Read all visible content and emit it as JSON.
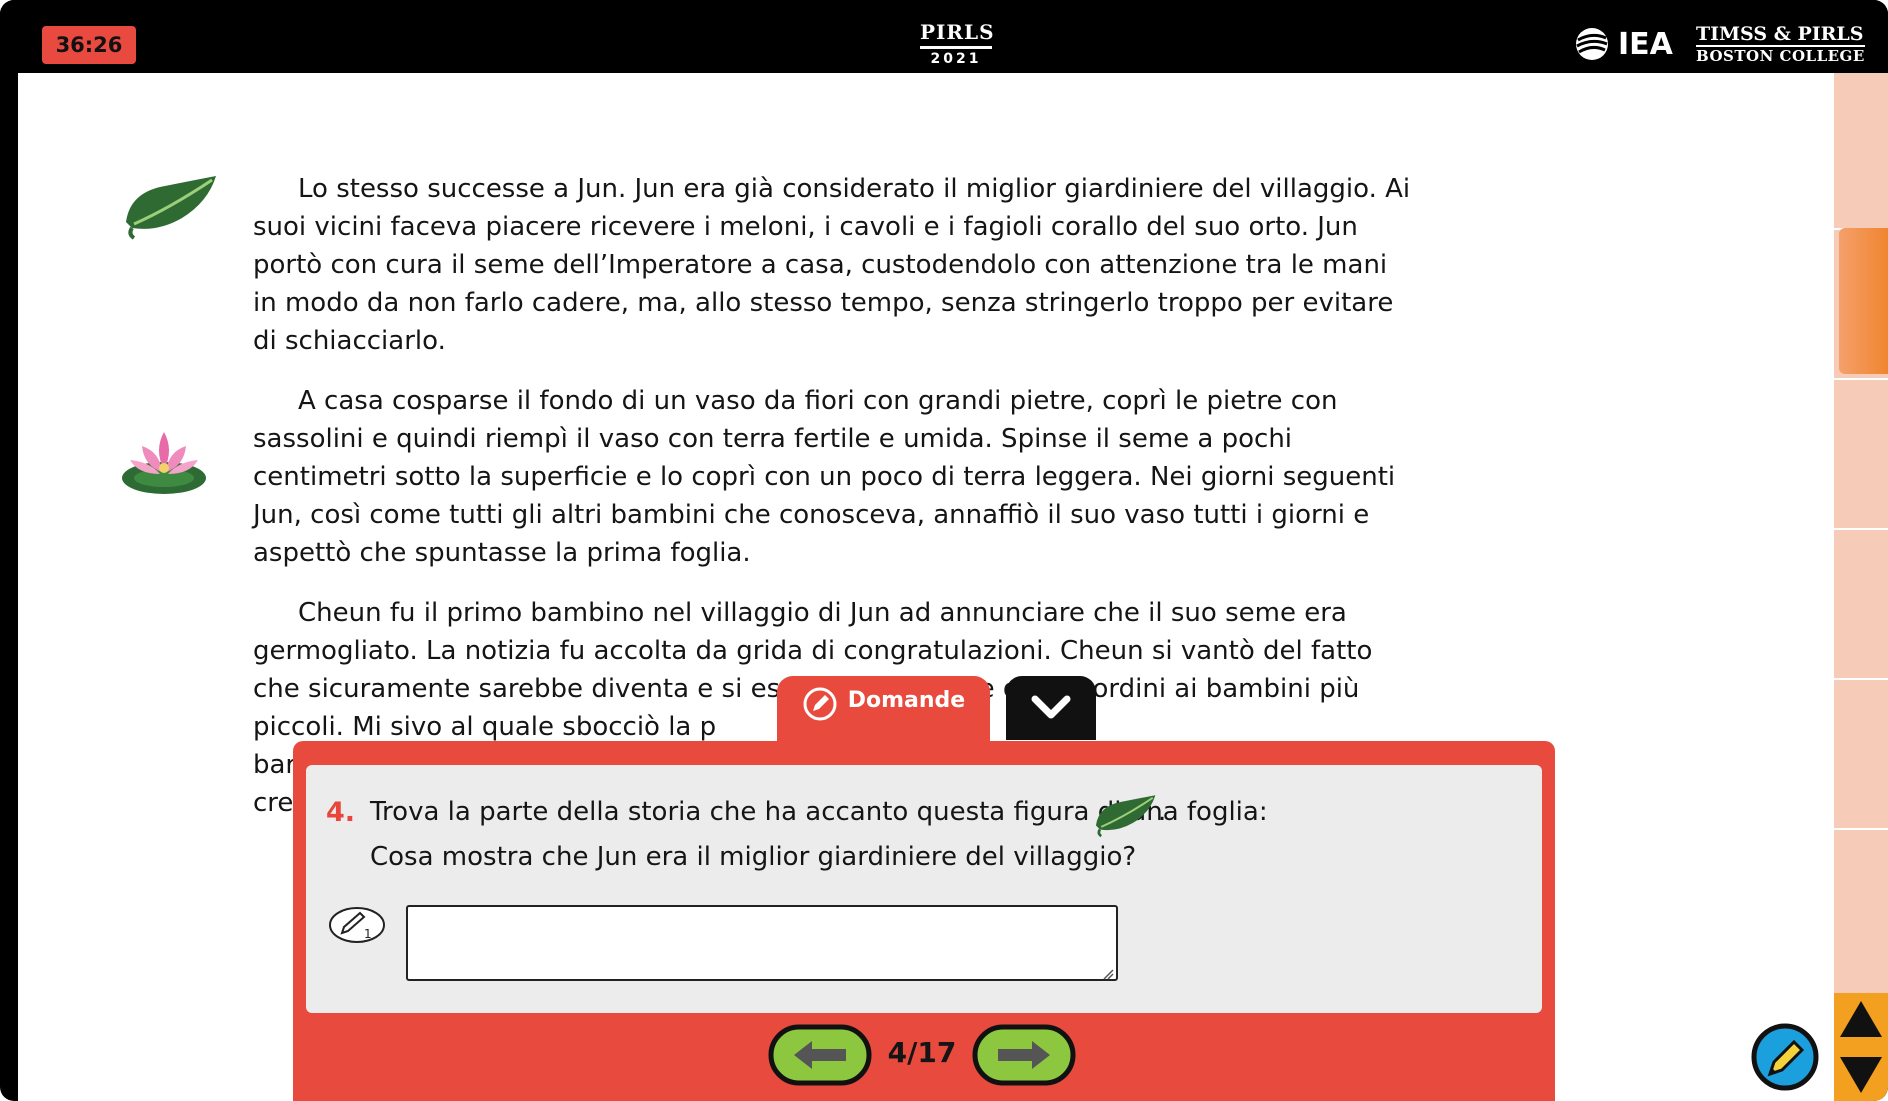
{
  "header": {
    "timer": "36:26",
    "program_line1": "PIRLS",
    "program_line2": "2021",
    "org": "IEA",
    "partner_line1": "TIMSS & PIRLS",
    "partner_line2": "BOSTON COLLEGE"
  },
  "story": {
    "paragraphs": [
      "Lo stesso successe a Jun. Jun era già considerato il miglior giardiniere del villaggio. Ai suoi vicini faceva piacere ricevere i meloni, i cavoli e i fagioli corallo del suo orto. Jun portò con cura il seme dell’Imperatore a casa, custodendolo con attenzione tra le mani in modo da non farlo cadere, ma, allo stesso tempo, senza stringerlo troppo per evitare di schiacciarlo.",
      "A casa cosparse il fondo di un vaso da fiori con grandi pietre, coprì le pietre con sassolini e quindi riempì il vaso con terra fertile e umida. Spinse il seme a pochi centimetri sotto la superficie e lo coprì con un poco di terra leggera. Nei giorni seguenti Jun, così come tutti gli altri bambini che conosceva, annaffiò il suo vaso tutti i giorni e aspettò che spuntasse la prima foglia.",
      "Cheun fu il primo bambino nel villaggio di Jun ad annunciare che il suo seme era germogliato. La notizia fu accolta da grida di congratulazioni. Cheun si vantò del fatto che sicuramente sarebbe diventa                   e si esercitò a fare il re dando ordini ai bambini più piccoli. Mi                         sivo al quale sbocciò la p\nbar\ncre"
    ]
  },
  "questions_panel": {
    "tab_label": "Domande",
    "number": "4.",
    "text_line1": "Trova la parte della storia che ha accanto questa figura di una foglia:",
    "text_line1_end": ".",
    "text_line2": "Cosa mostra che Jun era il miglior giardiniere del villaggio?",
    "answer_value": "",
    "points": "1",
    "page_indicator": "4/17"
  },
  "icons": {
    "leaf": "leaf-icon",
    "lotus": "lotus-flower-icon",
    "prev": "arrow-left-icon",
    "next": "arrow-right-icon",
    "collapse": "chevron-down-icon",
    "highlighter": "highlighter-pen-icon"
  },
  "colors": {
    "accent_red": "#e84a3d",
    "timer_bg": "#e94a3f",
    "nav_green": "#8dc63f",
    "rail": "#f6ccb8",
    "scroll_thumb": "#f0852f",
    "scroll_arrows": "#f39f1f"
  }
}
